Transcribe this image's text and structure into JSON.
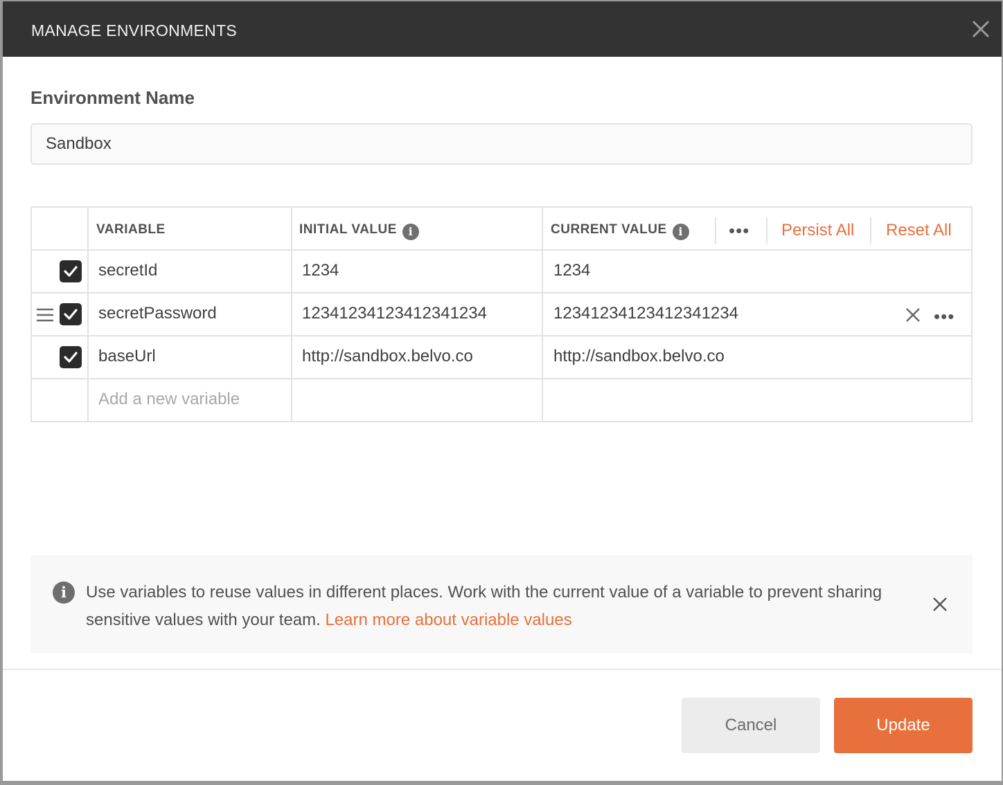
{
  "modal": {
    "title": "MANAGE ENVIRONMENTS",
    "env_name_label": "Environment Name",
    "env_name_value": "Sandbox"
  },
  "table": {
    "headers": {
      "variable": "VARIABLE",
      "initial_value": "INITIAL VALUE",
      "current_value": "CURRENT VALUE",
      "more": "•••",
      "persist_all": "Persist All",
      "reset_all": "Reset All"
    },
    "rows": [
      {
        "checked": true,
        "variable": "secretId",
        "initial": "1234",
        "current": "1234"
      },
      {
        "checked": true,
        "variable": "secretPassword",
        "initial": "12341234123412341234",
        "current": "12341234123412341234"
      },
      {
        "checked": true,
        "variable": "baseUrl",
        "initial": "http://sandbox.belvo.co",
        "current": "http://sandbox.belvo.co"
      }
    ],
    "new_row_placeholder": "Add a new variable",
    "row_more": "•••"
  },
  "info_banner": {
    "text": "Use variables to reuse values in different places. Work with the current value of a variable to prevent sharing sensitive values with your team.",
    "link": "Learn more about variable values"
  },
  "footer": {
    "cancel_label": "Cancel",
    "update_label": "Update"
  },
  "colors": {
    "header_bg": "#333333",
    "accent": "#e8703c",
    "checkbox": "#2b2b2b"
  },
  "icons": [
    "close-icon",
    "info-icon",
    "check-icon",
    "drag-handle-icon",
    "more-icon",
    "clear-icon"
  ]
}
